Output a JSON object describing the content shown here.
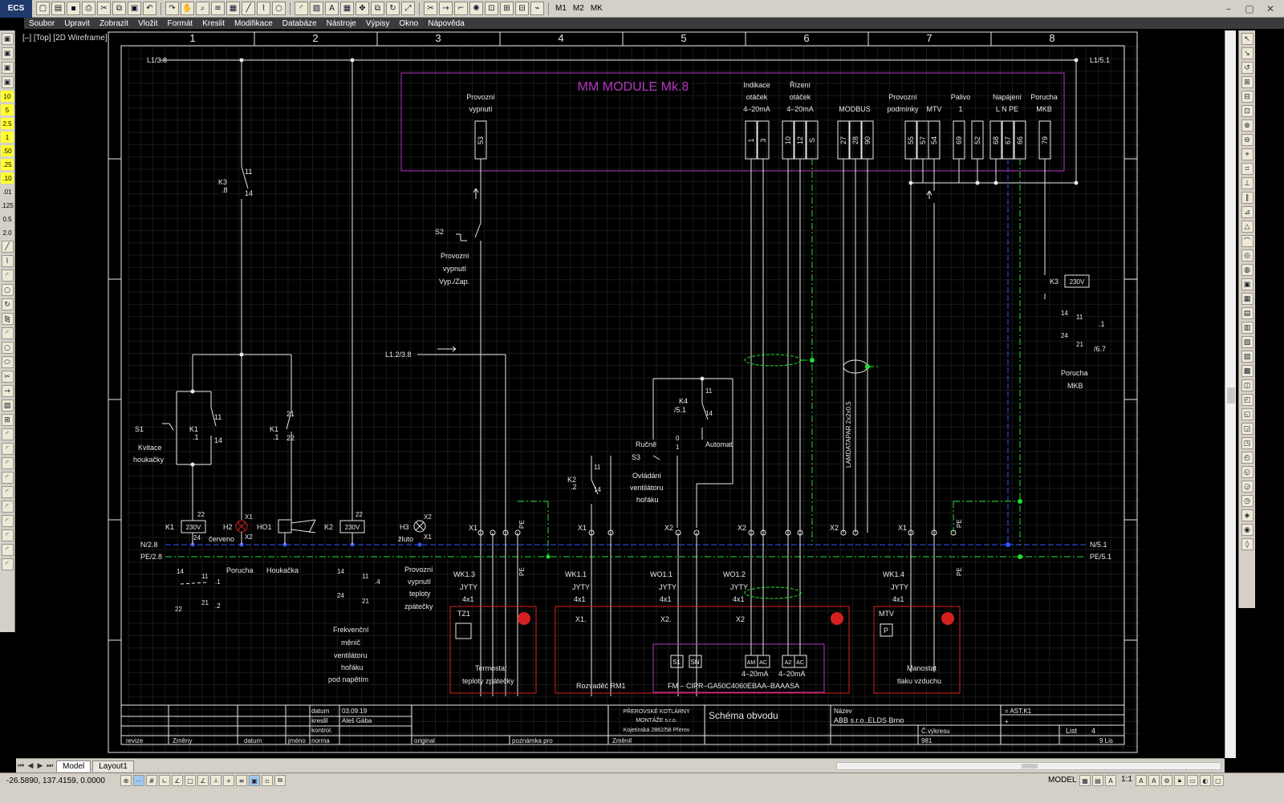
{
  "toolbar": {
    "app_button": "ECS",
    "icons": [
      "new-icon",
      "open-icon",
      "save-icon",
      "plot-icon",
      "cut-icon",
      "copy-icon",
      "paste-icon",
      "undo-icon",
      "redo-icon",
      "pan-icon",
      "zoom-icon",
      "layer-icon",
      "properties-icon",
      "line-icon",
      "polyline-icon",
      "circle-icon",
      "arc-icon",
      "hatch-icon",
      "text-icon",
      "table-icon",
      "move-icon",
      "copy-obj-icon",
      "rotate-icon",
      "scale-icon",
      "trim-icon",
      "extend-icon",
      "fillet-icon",
      "explode-icon",
      "zoom-window-icon",
      "zoom-all-icon",
      "zoom-prev-icon",
      "match-icon"
    ],
    "macro_labels": [
      "M1",
      "M2",
      "MK"
    ],
    "window_controls": [
      "–",
      "▢",
      "✕"
    ]
  },
  "menu": {
    "items": [
      "Soubor",
      "Upravit",
      "Zobrazit",
      "Vložit",
      "Formát",
      "Kreslit",
      "Modifikace",
      "Databáze",
      "Nástroje",
      "Výpisy",
      "Okno",
      "Nápověda"
    ]
  },
  "left_toolbar": {
    "scales": [
      "10",
      "5",
      "2.5",
      "1",
      ".50",
      ".25",
      ".10",
      ".01",
      ".125",
      "0.5",
      "2.0"
    ]
  },
  "viewport": {
    "label": "[–] [Top] [2D Wireframe]"
  },
  "drawing": {
    "columns": [
      "1",
      "2",
      "3",
      "4",
      "5",
      "6",
      "7",
      "8"
    ],
    "rails": {
      "l1_left": "L1/3.8",
      "l1_right": "L1/5.1",
      "n_left": "N/2.8",
      "n_right": "N/5.1",
      "pe_left": "PE/2.8",
      "pe_right": "PE/5.1",
      "l12": "L1.2/3.8"
    },
    "module": {
      "title": "MM  MODULE  Mk.8",
      "groups": [
        {
          "lines": [
            "Provozní",
            "vypnutí"
          ]
        },
        {
          "lines": [
            "Indikace",
            "otáček",
            "4–20mA"
          ]
        },
        {
          "lines": [
            "Řízení",
            "otáček",
            "4–20mA"
          ]
        },
        {
          "lines": [
            "MODBUS"
          ]
        },
        {
          "lines": [
            "Provozní",
            "podmínky"
          ]
        },
        {
          "lines": [
            "MTV"
          ]
        },
        {
          "lines": [
            "Palivo",
            "1"
          ]
        },
        {
          "lines": [
            "Napájení",
            "L  N  PE"
          ]
        },
        {
          "lines": [
            "Porucha",
            "MKB"
          ]
        }
      ],
      "terminals": [
        "53",
        "1",
        "3",
        "10",
        "12",
        "S",
        "27",
        "28",
        "90",
        "55",
        "57",
        "54",
        "69",
        "52",
        "68",
        "67",
        "66",
        "79"
      ]
    },
    "labels": {
      "k3_top": "K3",
      "k3_top_ref": ".8",
      "c11": "11",
      "c14": "14",
      "c21": "21",
      "c22": "22",
      "s1": "S1",
      "s1_desc1": "Kvitace",
      "s1_desc2": "houkačky",
      "k1": "K1",
      "k1_ref": ".1",
      "s2": "S2",
      "s2_desc1": "Provozní",
      "s2_desc2": "vypnutí",
      "s2_desc3": "Vyp./Zap.",
      "k1_coil": "K1",
      "k2_coil": "K2",
      "h2": "H2",
      "h3": "H3",
      "ho1": "HO1",
      "v230": "230V",
      "x1": "X1",
      "x2": "X2",
      "cerveno": "červeno",
      "zluto": "žluto",
      "porucha": "Porucha",
      "houkacka": "Houkačka",
      "k4": "K4",
      "k4_ref": "/5.1",
      "rucne": "Ručně",
      "automat": "Automat",
      "s3": "S3",
      "s3_pos0": "0",
      "s3_pos1": "1",
      "s3_desc1": "Ovládání",
      "s3_desc2": "ventilátoru",
      "s3_desc3": "hořáku",
      "k2_ref": "K2",
      "k2_ref2": ".2",
      "k3_right": "K3",
      "k3_right_a": "14",
      "k3_right_b": "11",
      "k3_right_c": ".1",
      "k3_right_d": "24",
      "k3_right_e": "21",
      "k3_right_f": "/6.7",
      "porucha_mkb1": "Porucha",
      "porucha_mkb2": "MKB",
      "landatapar": "LAMDATAPAR  2x2x0,5",
      "frek1": "Frekvenční",
      "frek2": "měnič",
      "frek3": "ventilátoru",
      "frek4": "hořáku",
      "frek5": "pod  napětím",
      "pv1": "Provozní",
      "pv2": "vypnutí",
      "pv3": "teploty",
      "pv4": "zpátečky",
      "wk13": "WK1.3",
      "wk11": "WK1.1",
      "wo11": "WO1.1",
      "wo12": "WO1.2",
      "wk14": "WK1.4",
      "jyty": "JYTY",
      "c4x1": "4x1",
      "tz1": "TZ1",
      "termostat1": "Termostat",
      "termostat2": "teploty  zpátečky",
      "rm1": "Rozvaděč  RM1",
      "fm": "FM  –  CIPR–GA50C4060EBAA–BAAASA",
      "mtv": "MTV",
      "manostat1": "Manostat",
      "manostat2": "tlaku  vzduchu",
      "s1_term": "S1",
      "sn_term": "SN",
      "am": "AM",
      "ac": "AC",
      "a2": "A2",
      "ac2": "AC",
      "ma1": "4–20mA",
      "ma2": "4–20mA",
      "p": "P",
      "pe": "PE",
      "x1dot": "X1.",
      "x2dot": "X2.",
      "ref_1": ".1",
      "ref_2": ".2",
      "ref_4": ".4",
      "c24": "24"
    },
    "titleblock": {
      "datum_label": "datum",
      "datum": "03.09.19",
      "kreslil_label": "kreslil",
      "kreslil": "Aleš Gába",
      "kontrol_label": "kontrol.",
      "revize": "revize",
      "zmeny": "Změny",
      "datum2": "datum",
      "jmeno": "jméno",
      "norma": "norma",
      "original": "original",
      "poznamka": "poznámka pro",
      "zmenil": "Změnil",
      "company1": "PŘEROVSKÉ KOTLÁRNY",
      "company2": "MONTÁŽE s.r.o.",
      "company3": "Kojetínská 2862/58 Přerov",
      "title": "Schéma obvodu",
      "nazev_label": "Název",
      "nazev": "ABB s.r.o.,ELDS Brno",
      "cvykresu_label": "Č.výkresu",
      "cvykresu": "981",
      "code": "= AST.K1",
      "plus": "+",
      "list_label": "List",
      "list": "4",
      "listu": "9 Lis"
    }
  },
  "tabs": [
    "Model",
    "Layout1"
  ],
  "status": {
    "coords": "-26.5890, 137.4159, 0.0000",
    "model": "MODEL",
    "scale": "1:1"
  }
}
